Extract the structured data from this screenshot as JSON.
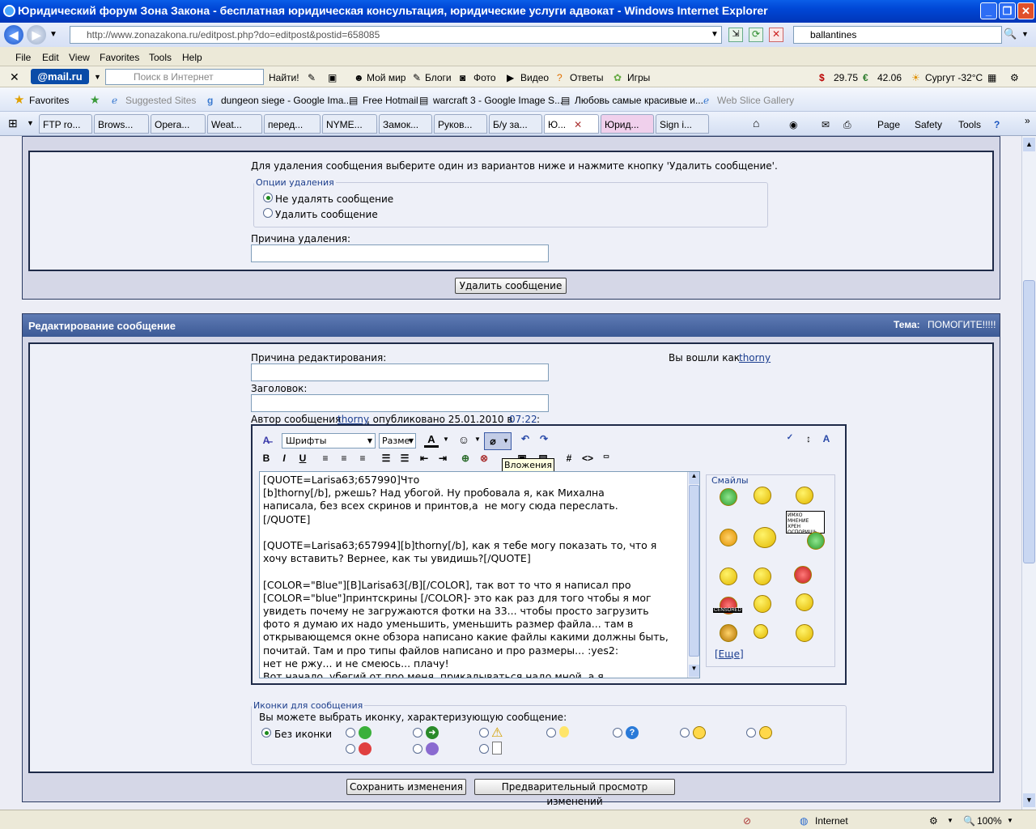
{
  "window": {
    "title": "Юридический форум Зона Закона - бесплатная юридическая консультация, юридические услуги адвокат - Windows Internet Explorer"
  },
  "address": {
    "url": "http://www.zonazakona.ru/editpost.php?do=editpost&postid=658085",
    "search": "ballantines"
  },
  "menu": [
    "File",
    "Edit",
    "View",
    "Favorites",
    "Tools",
    "Help"
  ],
  "mailbar": {
    "logo": "@mail.ru",
    "search_placeholder": "Поиск в Интернет",
    "find": "Найти!",
    "items": [
      "Мой мир",
      "Блоги",
      "Фото",
      "Видео",
      "Ответы",
      "Игры"
    ],
    "usd": "29.75",
    "eur": "42.06",
    "weather": "Сургут -32°C"
  },
  "favbar": {
    "favorites": "Favorites",
    "items": [
      "Suggested Sites",
      "dungeon siege - Google Ima...",
      "Free Hotmail",
      "warcraft 3 - Google Image S...",
      "Любовь самые красивые и...",
      "Web Slice Gallery"
    ]
  },
  "tabs": [
    "FTP ro...",
    "Brows...",
    "Opera...",
    "Weat...",
    "перед...",
    "NYME...",
    "Замок...",
    "Руков...",
    "Б/у за...",
    "Ю...",
    "Юрид...",
    "Sign i..."
  ],
  "cmdbar": {
    "page": "Page",
    "safety": "Safety",
    "tools": "Tools"
  },
  "delete": {
    "intro": "Для удаления сообщения выберите один из вариантов ниже и нажмите кнопку 'Удалить сообщение'.",
    "legend": "Опции удаления",
    "opt1": "Не удалять сообщение",
    "opt2": "Удалить сообщение",
    "reason_label": "Причина удаления:",
    "button": "Удалить сообщение"
  },
  "edit": {
    "header": "Редактирование сообщение",
    "topic_label": "Тема:",
    "topic": "ПОМОГИТЕ!!!!!",
    "reason_label": "Причина редактирования:",
    "logged_label": "Вы вошли как",
    "user": "thorny",
    "title_label": "Заголовок:",
    "author_prefix": "Автор сообщения",
    "author": "thorny",
    "published": ", опубликовано 25.01.2010 в",
    "time": "07:22",
    ":": ":"
  },
  "toolbar": {
    "fonts": "Шрифты",
    "size": "Разме",
    "tooltip": "Вложения"
  },
  "editor_text": "[QUOTE=Larisa63;657990]Что\n[b]thorny[/b], ржешь? Над убогой. Ну пробовала я, как Михална\nнаписала, без всех скринов и принтов,а  не могу сюда переслать.\n[/QUOTE]\n\n[QUOTE=Larisa63;657994][b]thorny[/b], как я тебе могу показать то, что я\nхочу вставить? Вернее, как ты увидишь?[/QUOTE]\n\n[COLOR=\"Blue\"][B]Larisa63[/B][/COLOR], так вот то что я написал про\n[COLOR=\"blue\"]принтскрины [/COLOR]- это как раз для того чтобы я мог\nувидеть почему не загружаются фотки на 33... чтобы просто загрузить\nфото я думаю их надо уменьшить, уменьшить размер файла... там в\nоткрывающемся окне обзора написано какие файлы какими должны быть,\nпочитай. Там и про типы файлов написано и про размеры... :yes2:\nнет не ржу... и не смеюсь... плачу!\nВот начало, убегий от про меня, прикалываться надо мной, а я",
  "smilies": {
    "title": "Смайлы",
    "more": "[Еще]",
    "sign": "ИМХО МНЕНИЕ ХРЕН ОСПОРИШЬ",
    "censored": "CENSORED"
  },
  "icons": {
    "legend": "Иконки для сообщения",
    "desc": "Вы можете выбрать иконку, характеризующую сообщение:",
    "none": "Без иконки"
  },
  "buttons": {
    "save": "Сохранить изменения",
    "preview": "Предварительный просмотр изменений"
  },
  "status": {
    "zone": "Internet",
    "zoom": "100%"
  }
}
